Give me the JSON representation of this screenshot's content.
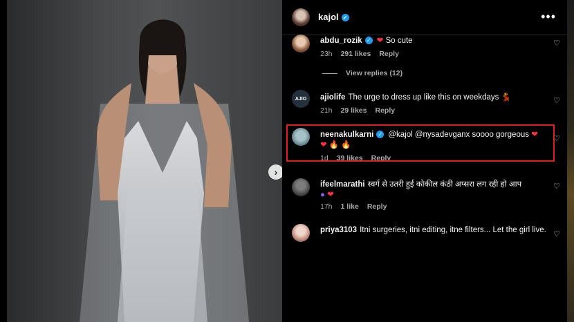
{
  "header": {
    "username": "kajol",
    "more_label": "•••"
  },
  "comments": [
    {
      "user": "abdu_rozik",
      "verified": true,
      "text": "So cute",
      "time": "23h",
      "likes": "291 likes",
      "reply": "Reply"
    },
    {
      "view_replies": "View replies (12)"
    },
    {
      "user": "ajiolife",
      "avatar_text": "AJIO",
      "text": "The urge to dress up like this on weekdays 💃",
      "time": "21h",
      "likes": "29 likes",
      "reply": "Reply"
    },
    {
      "user": "neenakulkarni",
      "verified": true,
      "text": "@kajol @nysadevganx soooo gorgeous",
      "time": "1d",
      "likes": "39 likes",
      "reply": "Reply"
    },
    {
      "user": "ifeelmarathi",
      "text": "स्वर्ग से उतरी हुई कोकील कंठी अप्सरा लग रही हो आप",
      "time": "17h",
      "likes": "1 like",
      "reply": "Reply"
    },
    {
      "user": "priya3103",
      "text": "Itni surgeries, itni editing, itne filters... Let the girl live."
    }
  ],
  "colors": {
    "highlight": "#e31b23",
    "verified": "#1d9bf0",
    "heart": "#ff3040"
  },
  "icons": {
    "next": "chevron-right-icon",
    "like": "heart-outline-icon",
    "more": "more-horizontal-icon"
  }
}
